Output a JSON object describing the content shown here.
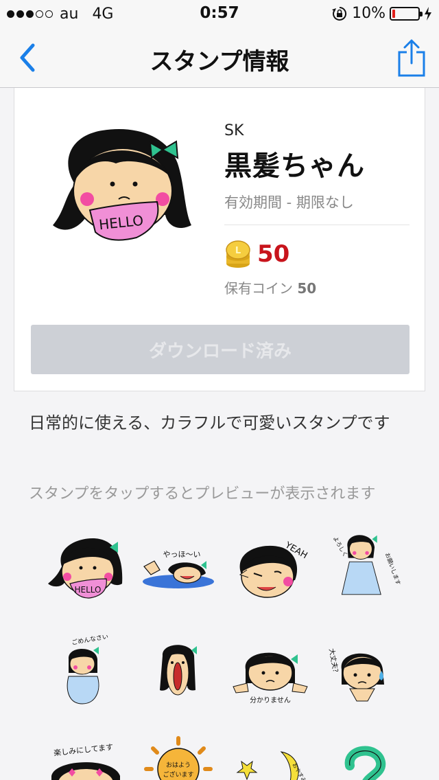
{
  "status_bar": {
    "carrier": "au",
    "network": "4G",
    "time": "0:57",
    "battery_percent": "10%",
    "battery_level": 0.1,
    "signal_bars": 3,
    "signal_total": 5
  },
  "nav": {
    "title": "スタンプ情報",
    "back_icon": "chevron-left-icon",
    "share_icon": "share-icon",
    "accent_color": "#1a7fe8"
  },
  "sticker": {
    "author": "SK",
    "title": "黒髪ちゃん",
    "validity": "有効期間 - 期限なし",
    "price": "50",
    "owned_label": "保有コイン",
    "owned_value": "50",
    "download_label": "ダウンロード済み",
    "main_sticker_text": "HELLO",
    "price_color": "#c8141c"
  },
  "description": "日常的に使える、カラフルで可愛いスタンプです",
  "preview_hint": "スタンプをタップするとプレビューが表示されます",
  "grid_stickers": [
    {
      "name": "hello",
      "text": "HELLO"
    },
    {
      "name": "yahho",
      "text": "やっほ〜い"
    },
    {
      "name": "yeah",
      "text": "YEAH"
    },
    {
      "name": "yoroshiku",
      "text": "よろしくお願いします"
    },
    {
      "name": "gomennasai",
      "text": "ごめんなさい"
    },
    {
      "name": "shocked",
      "text": ""
    },
    {
      "name": "wakarimasen",
      "text": "分かりません"
    },
    {
      "name": "daijoubu",
      "text": "大丈夫？"
    },
    {
      "name": "tanoshimi",
      "text": "楽しみにしてます"
    },
    {
      "name": "ohayou",
      "text": "おはようございます"
    },
    {
      "name": "oyasumi",
      "text": "おやすみ"
    },
    {
      "name": "question",
      "text": ""
    }
  ]
}
